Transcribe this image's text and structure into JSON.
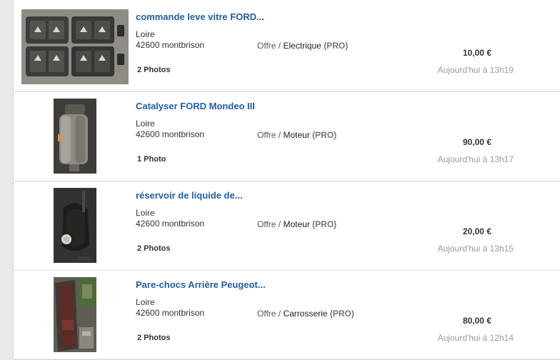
{
  "listings": [
    {
      "title": "commande leve vitre FORD...",
      "region": "Loire",
      "city": "42600 montbrison",
      "offer": "Offre / ",
      "category": "Electrique",
      "pro": "(PRO)",
      "photos": "2 Photos",
      "price": "10,00 €",
      "date": "Aujourd'hui à 13h19",
      "image_icon": "window-switch-photo"
    },
    {
      "title": "Catalyser FORD Mondeo III",
      "region": "Loire",
      "city": "42600 montbrison",
      "offer": "Offre / ",
      "category": "Moteur",
      "pro": "(PRO)",
      "photos": "1 Photo",
      "price": "90,00 €",
      "date": "Aujourd'hui à 13h17",
      "image_icon": "catalyser-photo"
    },
    {
      "title": "réservoir de liquide de...",
      "region": "Loire",
      "city": "42600 montbrison",
      "offer": "Offre / ",
      "category": "Moteur",
      "pro": "(PRO)",
      "photos": "2 Photos",
      "price": "20,00 €",
      "date": "Aujourd'hui à 13h15",
      "image_icon": "reservoir-photo"
    },
    {
      "title": "Pare-chocs Arrière Peugeot...",
      "region": "Loire",
      "city": "42600 montbrison",
      "offer": "Offre / ",
      "category": "Carrosserie",
      "pro": "(PRO)",
      "photos": "2 Photos",
      "price": "80,00 €",
      "date": "Aujourd'hui à 12h14",
      "image_icon": "bumper-photo"
    }
  ],
  "colors": {
    "title_link": "#1f5ea8",
    "date_text": "#9a9a9a",
    "background": "#e9eaec"
  }
}
